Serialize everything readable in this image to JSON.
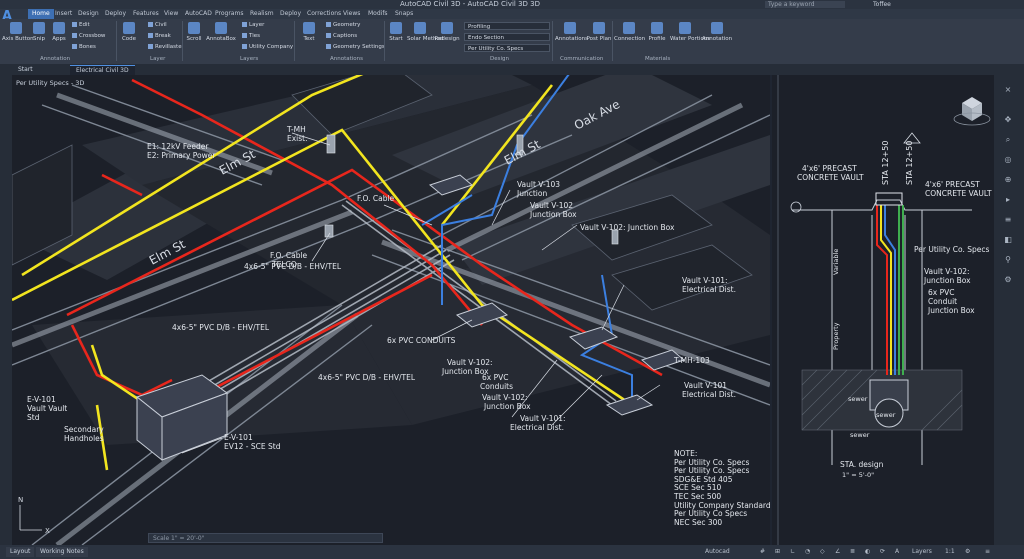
{
  "app": {
    "title": "AutoCAD Civil 3D - AutoCAD Civil 3D 3D",
    "search_placeholder": "Type a keyword",
    "user": "Toffee"
  },
  "ribbon_tabs": [
    "Home",
    "Insert",
    "Design",
    "Deploy",
    "Features",
    "View",
    "AutoCAD",
    "Programs",
    "Realism",
    "Deploy",
    "Corrections",
    "Views",
    "Modifs",
    "Snaps"
  ],
  "ribbon": {
    "annotation": {
      "buttons": [
        "Axis Button",
        "Snip",
        "Apps"
      ],
      "small": [
        "Edit",
        "Crossbow",
        "Bones"
      ],
      "label": "Annotation"
    },
    "layer": {
      "buttons": [
        "Code"
      ],
      "small": [
        "Civil",
        "Break",
        "Revillaste"
      ],
      "label": "Layer"
    },
    "layers": {
      "buttons": [
        "Scroll",
        "AnnotaBox"
      ],
      "small": [
        "Layer",
        "Ties",
        "Utility Company"
      ],
      "label": "Layers"
    },
    "annotations": {
      "buttons": [
        "Text"
      ],
      "small": [
        "Geometry",
        "Captions",
        "Geometry Settings"
      ],
      "label": "Annotations"
    },
    "design": {
      "buttons": [
        "Start",
        "Solar Method",
        "Redesign"
      ],
      "drops": [
        "Profiling",
        "Endo Section",
        "Per Utility Co. Specs"
      ],
      "label": "Design"
    },
    "communication": {
      "buttons": [
        "Annotations",
        "Post Plan"
      ],
      "label": "Communication"
    },
    "materials": {
      "buttons": [
        "Connection",
        "Profile",
        "Water Portions",
        "Annotation"
      ],
      "label": "Materials"
    }
  },
  "doc_tabs": [
    "Start",
    "Electrical Civil 3D"
  ],
  "viewport": {
    "title": "Per Utility Specs - 3D",
    "labels": {
      "elm_st_1": "Elm St",
      "elm_st_2": "Elm St",
      "oak_ave": "Oak Ave",
      "elm_st_3": "Elm St",
      "feeder_1": "E1: 12kV Feeder",
      "feeder_2": "E2: Primary Power",
      "tmh_1": "T-MH",
      "tmh_2": "Exist.",
      "fo_cable_1": "F.O. Cable",
      "fo_cable_2": "F.O. Cable",
      "telco": "TELCO",
      "vault_v103_1": "Vault V-103",
      "vault_v103_2": "Junction",
      "vault_v102_1": "Vault V-102",
      "vault_v102_2": "Junction Box",
      "vault_v102_3": "Vault V-102: Junction Box",
      "pvc_1": "4x6-5\" PVC D/B - EHV/TEL",
      "pvc_2": "4x6-5\" PVC D/B - EHV/TEL",
      "pvc_3": "4x6-5\" PVC D/B - EHV/TEL",
      "six_conduits": "6x PVC CONDUITS",
      "vault_v101_1": "Vault V-101:",
      "vault_v101_2": "Electrical Dist.",
      "vault_v102_4": "Vault V-102:",
      "vault_v102_5": "Junction Box",
      "tmh_103_1": "T-MH-103",
      "tmh_103_2": "Vault V-101",
      "tmh_103_3": "Electrical Dist.",
      "six_pvc_1": "6x PVC",
      "six_pvc_2": "Conduits",
      "vault_v102_6": "Vault V-102:",
      "vault_v102_7": "Junction Box",
      "vault_v101_3": "Vault V-101:",
      "vault_v101_4": "Electrical Dist.",
      "ev_101_1": "E-V-101",
      "ev_101_2": "Vault Vault",
      "ev_101_3": "Std",
      "secondary_1": "Secondary",
      "secondary_2": "Handholes",
      "ev_101_4": "E-V-101",
      "ev_101_5": "EV12 - SCE Std"
    },
    "notes": [
      "NOTE:",
      "Per Utility Co. Specs",
      "Per Utility Co. Specs",
      "SDG&E Std 405",
      "SCE Sec 510",
      "TEC Sec 500",
      "Utility Company Standards",
      "Per Utility Co Specs",
      "NEC Sec 300"
    ]
  },
  "section_panel": {
    "labels": {
      "vault_left_1": "4'x6' PRECAST",
      "vault_left_2": "CONCRETE VAULT",
      "sta_1": "STA 12+50",
      "sta_2": "STA 12+50",
      "vault_right_1": "4'x6' PRECAST",
      "vault_right_2": "CONCRETE VAULT",
      "specs": "Per Utility Co. Specs",
      "vault_v102_1": "Vault V-102:",
      "vault_v102_2": "Junction Box",
      "six_pvc_1": "6x PVC",
      "six_pvc_2": "Conduit",
      "six_pvc_3": "Junction Box",
      "variable": "Variable",
      "property": "Property",
      "sewer_1": "sewer",
      "sewer_2": "sewer",
      "sewer_3": "sewer",
      "sta_design": "STA. design",
      "scale": "1\" = 5'-0\""
    }
  },
  "command_line": "Scale 1\" = 20'-0\"",
  "status": {
    "layout_tabs": [
      "Layout",
      "Working Notes"
    ],
    "model": "Autocad",
    "items": [
      "Layers",
      "1:1"
    ]
  },
  "colors": {
    "red": "#e8261c",
    "yellow": "#f2e51f",
    "blue": "#3b7fe0",
    "accent": "#3d6fb3"
  }
}
